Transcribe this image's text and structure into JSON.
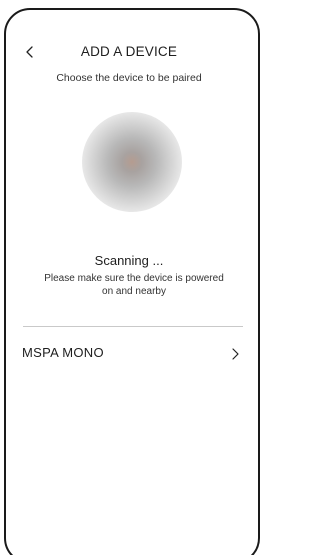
{
  "header": {
    "back_icon": "chevron-left-icon",
    "title": "ADD A DEVICE"
  },
  "subtitle": "Choose the device to be paired",
  "scan": {
    "status": "Scanning ...",
    "hint": "Please make sure the device is powered on and nearby"
  },
  "devices": [
    {
      "name": "MSPA MONO",
      "icon": "chevron-right-icon"
    }
  ],
  "colors": {
    "text": "#1e1e1e",
    "divider": "#c9c9c9",
    "frame": "#1a1a1a"
  }
}
